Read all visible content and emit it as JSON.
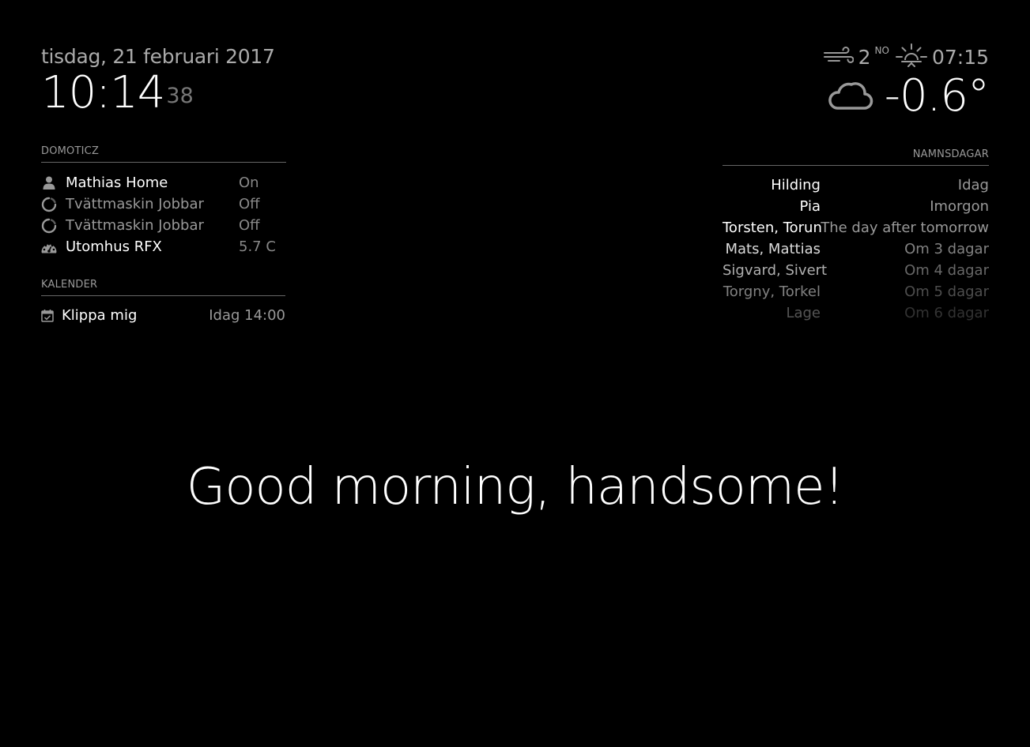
{
  "clock": {
    "date": "tisdag, 21 februari 2017",
    "time": "10:14",
    "seconds": "38"
  },
  "domoticz": {
    "header": "DOMOTICZ",
    "items": [
      {
        "icon": "user-icon",
        "name": "Mathias Home",
        "value": "On",
        "state": "on"
      },
      {
        "icon": "spinner-icon",
        "name": "Tvättmaskin Jobbar",
        "value": "Off",
        "state": "off"
      },
      {
        "icon": "spinner-icon",
        "name": "Tvättmaskin Jobbar",
        "value": "Off",
        "state": "off"
      },
      {
        "icon": "gauge-icon",
        "name": "Utomhus RFX",
        "value": "5.7 C",
        "state": "on"
      }
    ]
  },
  "calendar": {
    "header": "KALENDER",
    "events": [
      {
        "icon": "calendar-icon",
        "title": "Klippa mig",
        "time": "Idag 14:00"
      }
    ]
  },
  "weather": {
    "wind_icon": "wind-icon",
    "wind_speed": "2",
    "wind_direction": "NO",
    "sun_icon": "sunrise-icon",
    "sun_time": "07:15",
    "condition_icon": "cloud-icon",
    "temperature": "-0.6°"
  },
  "namedays": {
    "header": "NAMNSDAGAR",
    "rows": [
      {
        "names": "Hilding",
        "when": "Idag",
        "opacity": 1.0
      },
      {
        "names": "Pia",
        "when": "Imorgon",
        "opacity": 1.0
      },
      {
        "names": "Torsten, Torun",
        "when": "The day after tomorrow",
        "opacity": 1.0
      },
      {
        "names": "Mats, Mattias",
        "when": "Om 3 dagar",
        "opacity": 0.85
      },
      {
        "names": "Sigvard, Sivert",
        "when": "Om 4 dagar",
        "opacity": 0.68
      },
      {
        "names": "Torgny, Torkel",
        "when": "Om 5 dagar",
        "opacity": 0.5
      },
      {
        "names": "Lage",
        "when": "Om 6 dagar",
        "opacity": 0.33
      }
    ]
  },
  "compliment": {
    "text": "Good morning, handsome!"
  }
}
